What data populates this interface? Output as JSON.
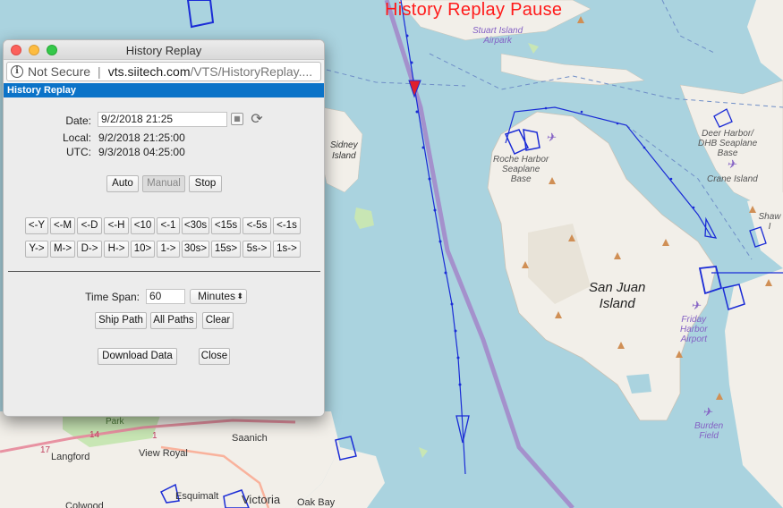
{
  "status_title": "History Replay Pause",
  "map_labels": {
    "stuart_airport": "Stuart Island\nAirpark",
    "sidney": "Sidney\nIsland",
    "roche_seaplane": "Roche Harbor\nSeaplane\nBase",
    "deer_harbor": "Deer Harbor/\nDHB Seaplane\nBase",
    "crane_island": "Crane Island",
    "shaw": "Shaw I",
    "san_juan": "San Juan\nIsland",
    "friday_harbor": "Friday\nHarbor\nAirport",
    "burden_field": "Burden\nField",
    "park": "Park",
    "hwy_14": "14",
    "hwy_1": "1",
    "hwy_17": "17",
    "saanich": "Saanich",
    "langford": "Langford",
    "view_royal": "View Royal",
    "esquimalt": "Esquimalt",
    "victoria": "Victoria",
    "oak_bay": "Oak Bay",
    "colwood": "Colwood"
  },
  "window": {
    "title": "History Replay",
    "url_security": "Not Secure",
    "url_host": "vts.siitech.com",
    "url_path": "/VTS/HistoryReplay...."
  },
  "panel": {
    "header": "History Replay",
    "date_label": "Date:",
    "date_value": "9/2/2018 21:25",
    "local_label": "Local:",
    "local_value": "9/2/2018 21:25:00",
    "utc_label": "UTC:",
    "utc_value": "9/3/2018 04:25:00",
    "auto_label": "Auto",
    "manual_label": "Manual",
    "stop_label": "Stop",
    "back_buttons": [
      "<-Y",
      "<-M",
      "<-D",
      "<-H",
      "<10",
      "<-1",
      "<30s",
      "<15s",
      "<-5s",
      "<-1s"
    ],
    "fwd_buttons": [
      "Y->",
      "M->",
      "D->",
      "H->",
      "10>",
      "1->",
      "30s>",
      "15s>",
      "5s->",
      "1s->"
    ],
    "timespan_label": "Time Span:",
    "timespan_value": "60",
    "unit_value": "Minutes",
    "ship_path_label": "Ship Path",
    "all_paths_label": "All Paths",
    "clear_label": "Clear",
    "download_label": "Download Data",
    "close_label": "Close"
  },
  "colors": {
    "water": "#aad3df",
    "land": "#f2efe9",
    "track": "#1a2bd6",
    "boundary": "#a385c9",
    "status": "#ff1a1a",
    "panel_header": "#0b73c8"
  },
  "icons": [
    "info-icon",
    "calendar-icon",
    "refresh-icon",
    "chevron-updown-icon",
    "airport-icon",
    "peak-icon",
    "vessel-icon"
  ]
}
